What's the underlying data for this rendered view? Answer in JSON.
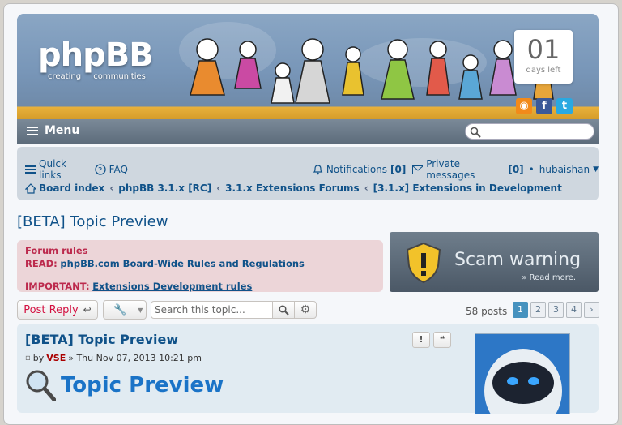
{
  "header": {
    "logo_text": "phpBB",
    "logo_tagline": "creating communities",
    "countdown_number": "01",
    "countdown_label": "days left",
    "social_icons": [
      "rss-icon",
      "facebook-icon",
      "twitter-icon"
    ]
  },
  "menubar": {
    "menu_label": "Menu",
    "search_placeholder": ""
  },
  "nav": {
    "quick_links": "Quick links",
    "faq": "FAQ",
    "notifications": "Notifications",
    "notifications_count": "[0]",
    "private_messages": "Private messages",
    "private_messages_count": "[0]",
    "username": "hubaishan",
    "breadcrumbs": [
      "Board index",
      "phpBB 3.1.x [RC]",
      "3.1.x Extensions Forums",
      "[3.1.x] Extensions in Development"
    ]
  },
  "topic": {
    "title": "[BETA] Topic Preview"
  },
  "rules": {
    "heading": "Forum rules",
    "read_label": "READ:",
    "read_link": "phpBB.com Board-Wide Rules and Regulations",
    "important_label": "IMPORTANT:",
    "important_link": "Extensions Development rules"
  },
  "scam": {
    "text": "Scam warning",
    "read_more": "» Read more."
  },
  "actionbar": {
    "post_reply": "Post Reply",
    "search_placeholder": "Search this topic...",
    "posts_count": "58 posts",
    "pages": [
      "1",
      "2",
      "3",
      "4"
    ],
    "current_page": "1"
  },
  "post": {
    "title": "[BETA] Topic Preview",
    "by": "by",
    "author": "VSE",
    "date": "» Thu Nov 07, 2013 10:21 pm",
    "report_label": "!",
    "quote_label": "❝",
    "content_heading": "Topic Preview"
  },
  "colors": {
    "link": "#105289",
    "accent_red": "#d31141",
    "page_active": "#4692bf"
  }
}
